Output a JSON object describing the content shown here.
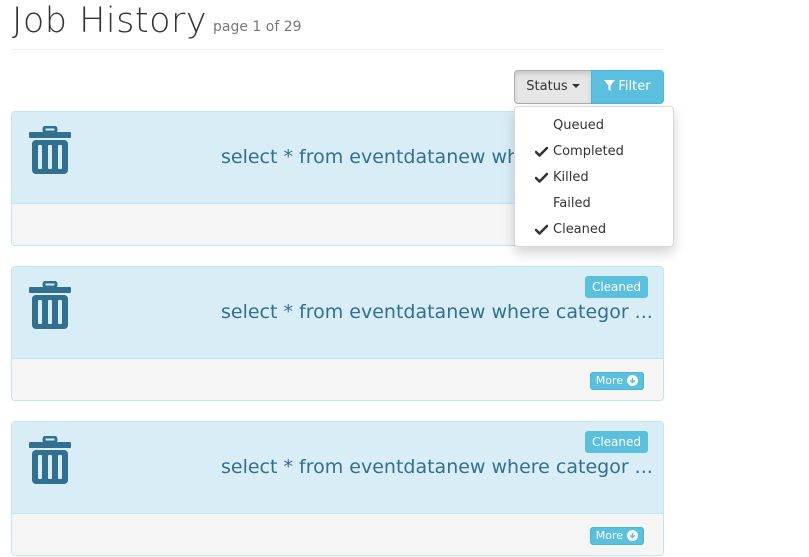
{
  "header": {
    "title": "Job History",
    "page_info": "page 1 of 29"
  },
  "toolbar": {
    "status_label": "Status",
    "filter_label": "Filter"
  },
  "status_menu": {
    "items": [
      {
        "label": "Queued",
        "checked": false
      },
      {
        "label": "Completed",
        "checked": true
      },
      {
        "label": "Killed",
        "checked": true
      },
      {
        "label": "Failed",
        "checked": false
      },
      {
        "label": "Cleaned",
        "checked": true
      }
    ]
  },
  "jobs": [
    {
      "query": "select * from eventdatanew whe",
      "status": "",
      "more_label": ""
    },
    {
      "query": "select * from eventdatanew where categor ...",
      "status": "Cleaned",
      "more_label": "More"
    },
    {
      "query": "select * from eventdatanew where categor ...",
      "status": "Cleaned",
      "more_label": "More"
    }
  ],
  "colors": {
    "accent": "#5bc0de",
    "panel": "#d9edf7",
    "panel_text": "#31708f",
    "icon": "#31708f"
  }
}
